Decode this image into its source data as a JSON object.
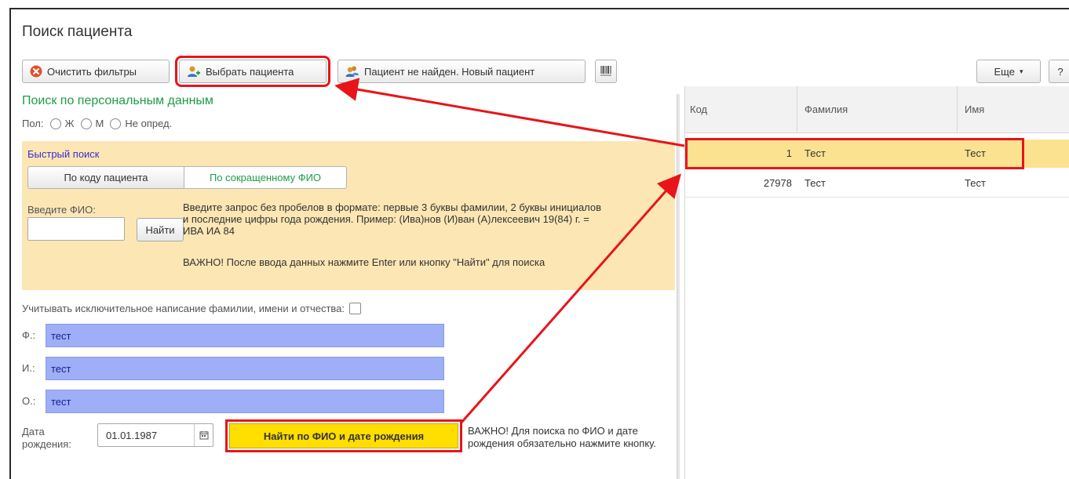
{
  "window": {
    "title": "Поиск пациента"
  },
  "toolbar": {
    "clear_filters": "Очистить фильтры",
    "select_patient": "Выбрать пациента",
    "new_patient": "Пациент не найден. Новый пациент",
    "more": "Еще",
    "help": "?"
  },
  "search": {
    "section_title": "Поиск по персональным данным",
    "gender_label": "Пол:",
    "gender_options": [
      "Ж",
      "М",
      "Не опред."
    ]
  },
  "quick_search": {
    "title": "Быстрый поиск",
    "tabs": [
      "По коду пациента",
      "По сокращенному ФИО"
    ],
    "active_tab": "По сокращенному ФИО",
    "fio_label": "Введите ФИО:",
    "fio_value": "",
    "find_button": "Найти",
    "hint": "Введите запрос без пробелов в формате: первые 3 буквы фамилии, 2 буквы инициалов и последние цифры года рождения. Пример: (Ива)нов (И)ван (А)лексеевич 19(84) г. = ИВА ИА 84",
    "hint_important": "ВАЖНО! После ввода данных нажмите Enter или кнопку \"Найти\" для поиска"
  },
  "exact": {
    "label": "Учитывать исключительное написание фамилии, имени и отчества:",
    "checked": false
  },
  "fields": {
    "surname_label": "Ф.:",
    "surname_value": "тест",
    "name_label": "И.:",
    "name_value": "тест",
    "patronymic_label": "О.:",
    "patronymic_value": "тест"
  },
  "dob": {
    "label": "Дата рождения:",
    "value": "01.01.1987",
    "find_button": "Найти по ФИО и дате рождения",
    "hint": "ВАЖНО! Для поиска по ФИО и дате рождения обязательно нажмите кнопку."
  },
  "results": {
    "columns": [
      "Код",
      "Фамилия",
      "Имя"
    ],
    "rows": [
      {
        "code": "1",
        "surname": "Тест",
        "name": "Тест",
        "selected": true
      },
      {
        "code": "27978",
        "surname": "Тест",
        "name": "Тест",
        "selected": false
      }
    ]
  },
  "colors": {
    "highlight": "#e8141a",
    "accent_green": "#1f9b49",
    "selected_row": "#fbe291",
    "field_fill": "#9eaef7",
    "find_button": "#ffde00"
  }
}
